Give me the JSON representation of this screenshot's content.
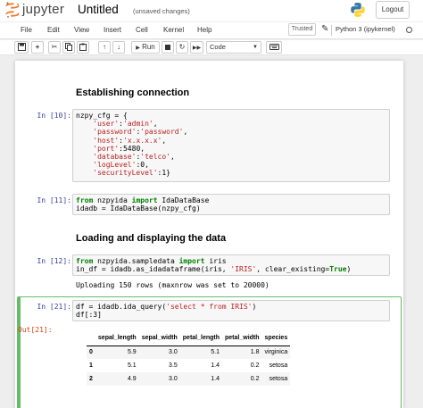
{
  "header": {
    "logo_text": "jupyter",
    "notebook_title": "Untitled",
    "save_status": "(unsaved changes)",
    "logout_label": "Logout"
  },
  "menubar": {
    "items": [
      "File",
      "Edit",
      "View",
      "Insert",
      "Cell",
      "Kernel",
      "Help"
    ],
    "trusted_label": "Trusted",
    "kernel_name": "Python 3 (ipykernel)"
  },
  "toolbar": {
    "run_label": "Run",
    "cell_type": "Code",
    "icons": [
      "save-icon",
      "plus-icon",
      "cut-icon",
      "copy-icon",
      "paste-icon",
      "arrow-up-icon",
      "arrow-down-icon",
      "run-icon",
      "stop-icon",
      "restart-icon",
      "fast-forward-icon",
      "keyboard-icon"
    ]
  },
  "cells": {
    "heading1": "Establishing connection",
    "cell1_prompt": "In [10]:",
    "cell2_prompt": "In [11]:",
    "heading2": "Loading and displaying the data",
    "cell3_prompt": "In [12]:",
    "cell3_output": "Uploading 150 rows (maxnrow was set to 20000)",
    "cell4_prompt": "In [21]:",
    "cell4_out_prompt": "Out[21]:"
  },
  "dataframe": {
    "columns": [
      "",
      "sepal_length",
      "sepal_width",
      "petal_length",
      "petal_width",
      "species"
    ],
    "rows": [
      [
        "0",
        "5.9",
        "3.0",
        "5.1",
        "1.8",
        "virginica"
      ],
      [
        "1",
        "5.1",
        "3.5",
        "1.4",
        "0.2",
        "setosa"
      ],
      [
        "2",
        "4.9",
        "3.0",
        "1.4",
        "0.2",
        "setosa"
      ]
    ]
  },
  "colors": {
    "jupyter_orange": "#f37626",
    "prompt_in": "#303f9f",
    "prompt_out": "#d84315",
    "selected_cell_border": "#66bb6a"
  }
}
